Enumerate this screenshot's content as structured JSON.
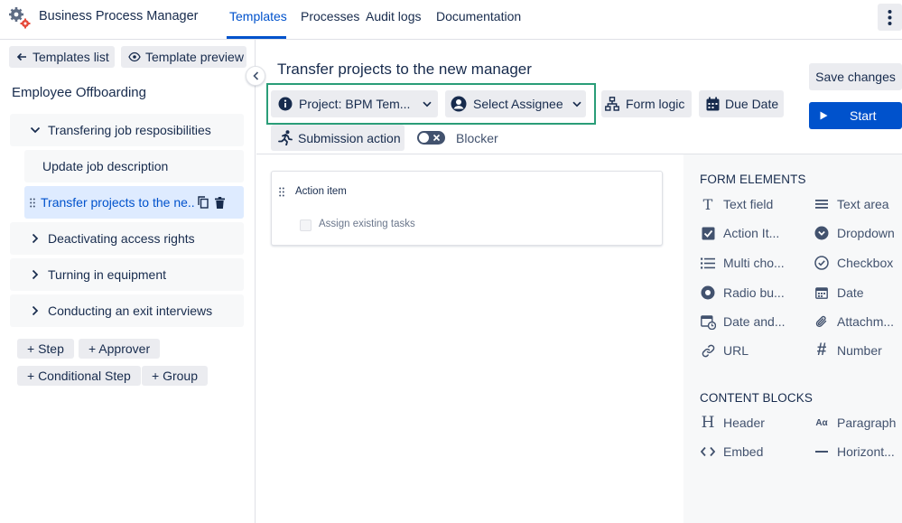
{
  "app": {
    "title": "Business Process Manager"
  },
  "nav": {
    "tabs": [
      "Templates",
      "Processes",
      "Audit logs",
      "Documentation"
    ],
    "active": "Templates"
  },
  "left": {
    "templates_list_label": "Templates list",
    "template_preview_label": "Template preview",
    "workflow_title": "Employee Offboarding",
    "steps": [
      {
        "label": "Transfering job resposibilities",
        "state": "expanded"
      },
      {
        "label": "Update job description",
        "state": "child"
      },
      {
        "label": "Transfer projects to the ne...",
        "state": "selected"
      },
      {
        "label": "Deactivating access rights",
        "state": "collapsed"
      },
      {
        "label": "Turning in equipment",
        "state": "collapsed"
      },
      {
        "label": "Conducting an exit interviews",
        "state": "collapsed"
      }
    ],
    "add_buttons": [
      "+ Step",
      "+ Approver",
      "+ Conditional Step",
      "+ Group"
    ]
  },
  "main": {
    "title": "Transfer projects to the new manager",
    "project_label": "Project: BPM Tem...",
    "assignee_label": "Select Assignee",
    "form_logic_label": "Form logic",
    "due_date_label": "Due Date",
    "submission_action_label": "Submission action",
    "blocker_label": "Blocker",
    "blocker_on": false,
    "card": {
      "title": "Action item",
      "item": "Assign existing tasks"
    }
  },
  "actions": {
    "save_label": "Save changes",
    "start_label": "Start"
  },
  "right": {
    "form_elements_heading": "FORM ELEMENTS",
    "form_elements": [
      {
        "label": "Text field",
        "icon": "text-icon"
      },
      {
        "label": "Text area",
        "icon": "text-area-icon"
      },
      {
        "label": "Action It...",
        "icon": "checkbox-checked-icon"
      },
      {
        "label": "Dropdown",
        "icon": "dropdown-icon"
      },
      {
        "label": "Multi cho...",
        "icon": "list-icon"
      },
      {
        "label": "Checkbox",
        "icon": "check-circle-icon"
      },
      {
        "label": "Radio bu...",
        "icon": "radio-icon"
      },
      {
        "label": "Date",
        "icon": "calendar-icon"
      },
      {
        "label": "Date and...",
        "icon": "calendar-clock-icon"
      },
      {
        "label": "Attachm...",
        "icon": "paperclip-icon"
      },
      {
        "label": "URL",
        "icon": "link-icon"
      },
      {
        "label": "Number",
        "icon": "hash-icon"
      }
    ],
    "content_blocks_heading": "CONTENT BLOCKS",
    "content_blocks": [
      {
        "label": "Header",
        "icon": "header-icon"
      },
      {
        "label": "Paragraph",
        "icon": "paragraph-icon"
      },
      {
        "label": "Embed",
        "icon": "code-icon"
      },
      {
        "label": "Horizont...",
        "icon": "horizontal-rule-icon"
      }
    ]
  },
  "colors": {
    "accent": "#0052cc",
    "highlight": "#2a9d78",
    "chip": "#ebecf0",
    "selected": "#deebff"
  }
}
